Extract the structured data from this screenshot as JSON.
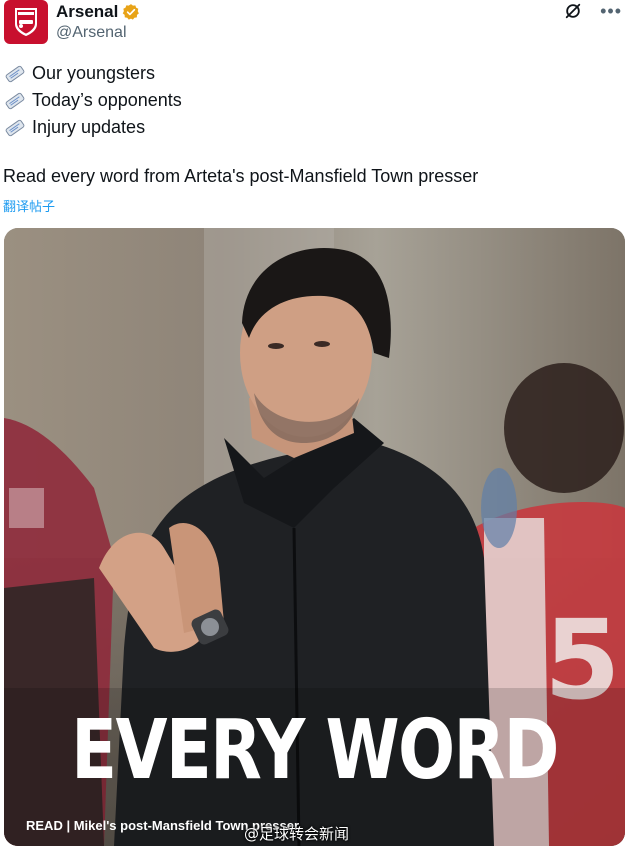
{
  "account": {
    "display_name": "Arsenal",
    "handle": "@Arsenal",
    "verified_color": "#e8a317",
    "brand_color": "#c8102e"
  },
  "tweet": {
    "bullets": [
      {
        "icon": "newspaper-icon",
        "text": "Our youngsters"
      },
      {
        "icon": "newspaper-icon",
        "text": "Today’s opponents"
      },
      {
        "icon": "newspaper-icon",
        "text": "Injury updates"
      }
    ],
    "text": "Read every word from Arteta's post-Mansfield Town presser",
    "translate_label": "翻译帖子"
  },
  "media": {
    "headline": "EVERY WORD",
    "caption": "READ | Mikel's post-Mansfield Town presser"
  },
  "watermark": "@足球转会新闻"
}
